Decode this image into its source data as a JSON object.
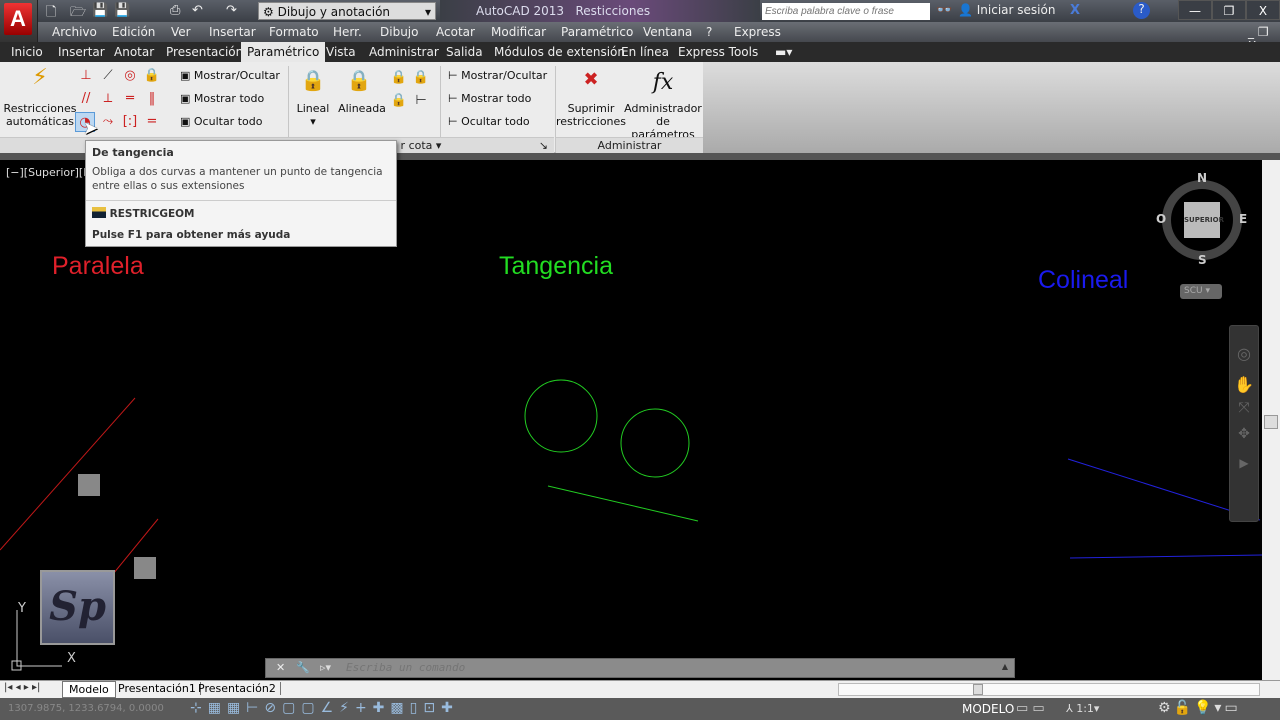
{
  "titlebar": {
    "workspace": "Dibujo y anotación",
    "app": "AutoCAD 2013",
    "file": "Resticciones parametricas.dwg",
    "search_placeholder": "Escriba palabra clave o frase",
    "login": "Iniciar sesión",
    "help": "?"
  },
  "menu": [
    "Archivo",
    "Edición",
    "Ver",
    "Insertar",
    "Formato",
    "Herr.",
    "Dibujo",
    "Acotar",
    "Modificar",
    "Paramétrico",
    "Ventana",
    "?",
    "Express"
  ],
  "tabs": [
    "Inicio",
    "Insertar",
    "Anotar",
    "Presentación",
    "Paramétrico",
    "Vista",
    "Administrar",
    "Salida",
    "Módulos de extensión",
    "En línea",
    "Express Tools"
  ],
  "ribbon": {
    "auto_constraints": "Restricciones automáticas",
    "auto1": "Restricciones",
    "auto2": "automáticas",
    "geo_show": "Mostrar/Ocultar",
    "geo_showall": "Mostrar todo",
    "geo_hideall": "Ocultar todo",
    "linear": "Lineal",
    "aligned": "Alineada",
    "dim_show": "Mostrar/Ocultar",
    "dim_showall": "Mostrar todo",
    "dim_hideall": "Ocultar todo",
    "dim_panel": "r cota",
    "suppress1": "Suprimir",
    "suppress2": "restricciones",
    "params1": "Administrador",
    "params2": "de parámetros",
    "manage_panel": "Administrar"
  },
  "tooltip": {
    "title": "De tangencia",
    "desc": "Obliga a dos curvas a mantener un punto de tangencia entre ellas o sus extensiones",
    "command": "RESTRICGEOM",
    "help": "Pulse F1 para obtener más ayuda"
  },
  "viewport": {
    "label": "[−][Superior][Es",
    "paralela": "Paralela",
    "tangencia": "Tangencia",
    "colineal": "Colineal",
    "compass": {
      "n": "N",
      "s": "S",
      "e": "E",
      "o": "O",
      "face": "SUPERIOR",
      "ucs": "SCU"
    },
    "logo": "Sp"
  },
  "colors": {
    "paralela": "#e0202a",
    "tangencia": "#22dd22",
    "colineal": "#1a1aee"
  },
  "command": {
    "placeholder": "Escriba un comando"
  },
  "layouts": [
    "Modelo",
    "Presentación1",
    "Presentación2"
  ],
  "status": {
    "coords": "1307.9875, 1233.6794, 0.0000",
    "model": "MODELO",
    "scale": "1:1"
  }
}
